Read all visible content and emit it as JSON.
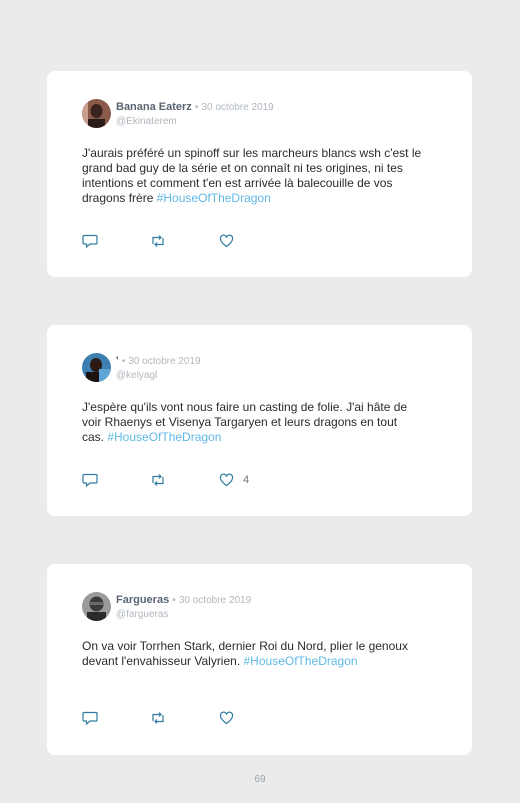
{
  "tweets": [
    {
      "name": "Banana Eaterz",
      "separator": "•",
      "date": "30 octobre 2019",
      "handle": "@Ekinaterem",
      "text": "J'aurais préféré un spinoff sur les marcheurs blancs wsh c'est le grand bad guy de la série et on connaît ni tes origines, ni tes intentions et comment t'en est arrivée là balecouille de vos dragons frère ",
      "hashtag": "#HouseOfTheDragon",
      "like_count": ""
    },
    {
      "name": "'",
      "separator": "•",
      "date": "30 octobre 2019",
      "handle": "@kelyagl",
      "text": "J'espère qu'ils vont nous faire un casting de folie. J'ai hâte de voir Rhaenys et Visenya Targaryen et leurs dragons en tout cas. ",
      "hashtag": "#HouseOfTheDragon",
      "like_count": "4"
    },
    {
      "name": "Fargueras",
      "separator": "•",
      "date": "30 octobre 2019",
      "handle": "@fargueras",
      "text": "On va voir Torrhen Stark, dernier Roi du Nord, plier le genoux devant l'envahisseur Valyrien. ",
      "hashtag": "#HouseOfTheDragon",
      "like_count": ""
    }
  ],
  "page_number": "69",
  "colors": {
    "hashtag": "#5fb8e6",
    "background": "#ebebeb",
    "card": "#ffffff"
  },
  "icons": [
    "reply-icon",
    "retweet-icon",
    "like-icon"
  ]
}
